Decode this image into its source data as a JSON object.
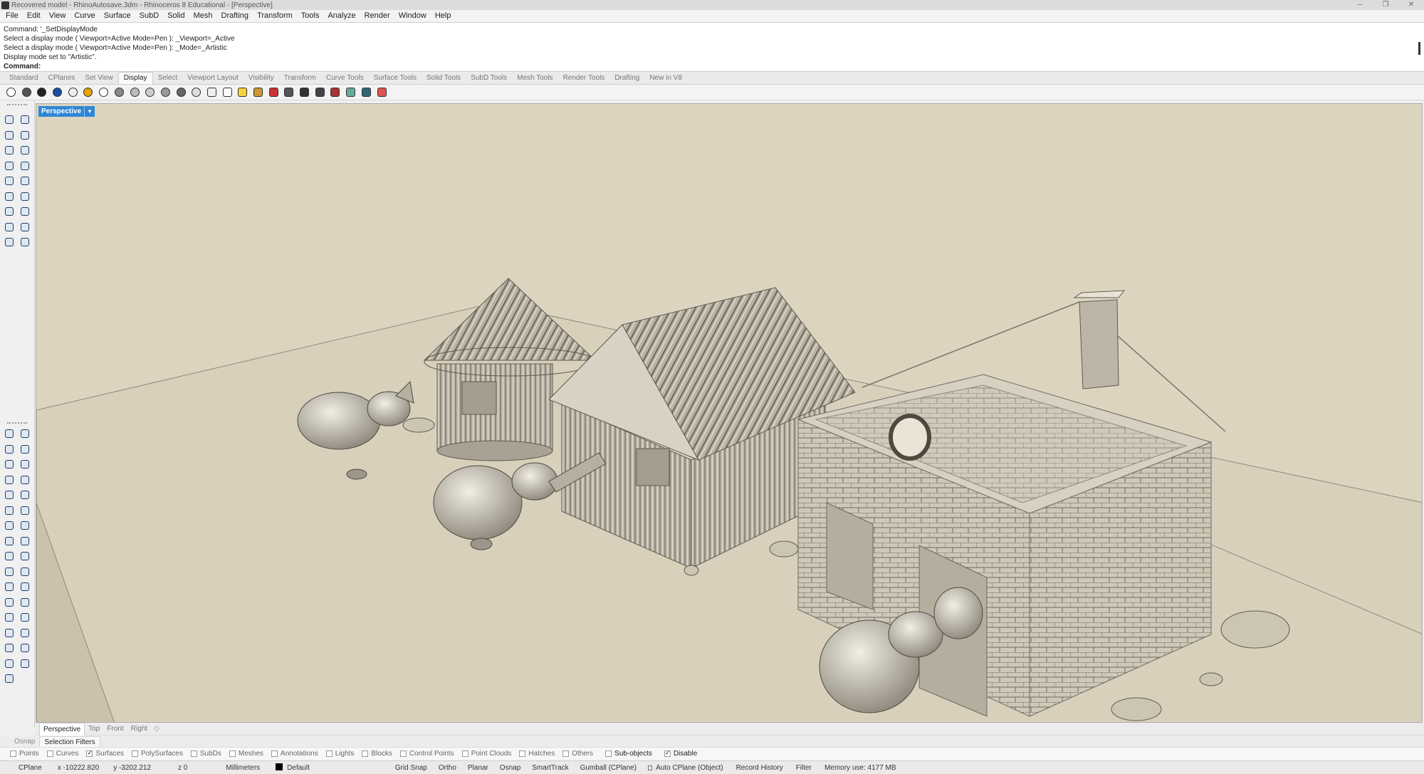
{
  "window": {
    "title": "Recovered model - RhinoAutosave.3dm - Rhinoceros 8 Educational - [Perspective]",
    "controls": [
      "–",
      "❐",
      "✕"
    ]
  },
  "menu": [
    "File",
    "Edit",
    "View",
    "Curve",
    "Surface",
    "SubD",
    "Solid",
    "Mesh",
    "Drafting",
    "Transform",
    "Tools",
    "Analyze",
    "Render",
    "Window",
    "Help"
  ],
  "command": {
    "history": [
      "Command: '_SetDisplayMode",
      "Select a display mode ( Viewport=Active  Mode=Pen ): _Viewport=_Active",
      "Select a display mode ( Viewport=Active  Mode=Pen ): _Mode=_Artistic",
      "Display mode set to \"Artistic\"."
    ],
    "prompt": "Command:"
  },
  "toolbar_tabs": [
    "Standard",
    "CPlanes",
    "Set View",
    "Display",
    "Select",
    "Viewport Layout",
    "Visibility",
    "Transform",
    "Curve Tools",
    "Surface Tools",
    "Solid Tools",
    "SubD Tools",
    "Mesh Tools",
    "Render Tools",
    "Drafting",
    "New in V8"
  ],
  "active_tab": "Display",
  "display_icons": [
    "wireframe-mode-icon",
    "shaded-mode-icon",
    "rendered-mode-icon",
    "ghosted-mode-icon",
    "xray-mode-icon",
    "technical-mode-icon",
    "artistic-mode-icon",
    "pen-mode-icon",
    "arctic-mode-icon",
    "raytraced-mode-icon",
    "monochrome-mode-icon",
    "shadows-icon",
    "silhouette-icon",
    "grid-toggle-icon",
    "axes-toggle-icon",
    "sun-icon",
    "material-ball-icon",
    "gumball-icon",
    "camera-icon",
    "clipping-plane-icon",
    "snapshot-icon",
    "zoom-to-selected-icon",
    "background-icon",
    "display-options-icon",
    "color-palette-icon"
  ],
  "viewport": {
    "name": "Perspective",
    "tabs": [
      "Perspective",
      "Top",
      "Front",
      "Right"
    ],
    "add_symbol": "◇",
    "background_color": "#ddd4c0"
  },
  "panel_tabs": [
    "Osnap",
    "Selection Filters"
  ],
  "active_panel": "Selection Filters",
  "filters": [
    {
      "label": "Points",
      "checked": false
    },
    {
      "label": "Curves",
      "checked": false
    },
    {
      "label": "Surfaces",
      "checked": true
    },
    {
      "label": "PolySurfaces",
      "checked": false
    },
    {
      "label": "SubDs",
      "checked": false
    },
    {
      "label": "Meshes",
      "checked": false
    },
    {
      "label": "Annotations",
      "checked": false
    },
    {
      "label": "Lights",
      "checked": false
    },
    {
      "label": "Blocks",
      "checked": false
    },
    {
      "label": "Control Points",
      "checked": false
    },
    {
      "label": "Point Clouds",
      "checked": false
    },
    {
      "label": "Hatches",
      "checked": false
    },
    {
      "label": "Others",
      "checked": false
    }
  ],
  "extra_filters": [
    {
      "label": "Sub-objects",
      "checked": false
    },
    {
      "label": "Disable",
      "checked": true
    }
  ],
  "status": {
    "cplane": "CPlane",
    "x": "x -10222.820",
    "y": "y -3202.212",
    "z": "z 0",
    "units": "Millimeters",
    "layer": "Default",
    "layer_color": "#000000",
    "grid_snap": "Grid Snap",
    "ortho": "Ortho",
    "planar": "Planar",
    "osnap": "Osnap",
    "smarttrack": "SmartTrack",
    "gumball": "Gumball (CPlane)",
    "auto_cplane": "Auto CPlane (Object)",
    "record_history": "Record History",
    "filter": "Filter",
    "memory": "Memory use: 4177 MB"
  },
  "side_strip_label": "Sele"
}
